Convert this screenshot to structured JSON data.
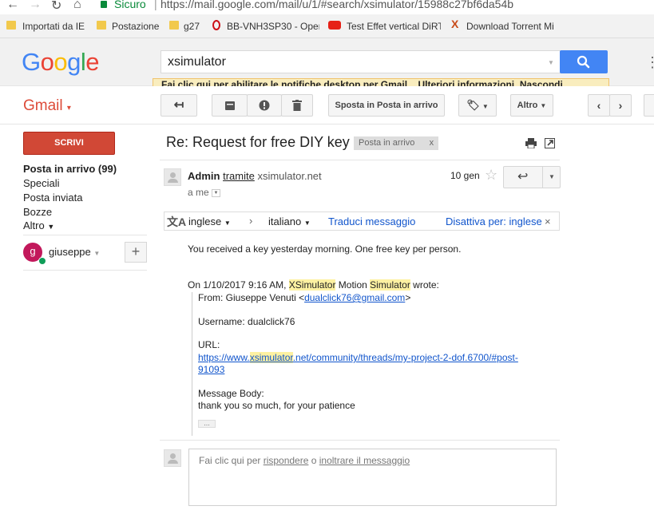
{
  "browser": {
    "secure_label": "Sicuro",
    "url": "https://mail.google.com/mail/u/1/#search/xsimulator/15988c27bf6da54b",
    "bookmarks": [
      {
        "label": "Importati da IE"
      },
      {
        "label": "Postazione"
      },
      {
        "label": "g27"
      },
      {
        "label": "BB-VNH3SP30 - Oper"
      },
      {
        "label": "Test Effet vertical DiRT"
      },
      {
        "label": "Download Torrent Mi"
      }
    ]
  },
  "header": {
    "logo": "Google",
    "search_value": "xsimulator"
  },
  "notification": {
    "enable_link": "Fai clic qui per abilitare",
    "text": " le notifiche desktop per Gmail.",
    "more_link": "Ulteriori informazioni",
    "hide_link": "Nascondi"
  },
  "toolbar": {
    "app_label": "Gmail",
    "move_inbox_label": "Sposta in Posta in arrivo",
    "more_label": "Altro"
  },
  "sidebar": {
    "compose_label": "SCRIVI",
    "items": [
      {
        "label": "Posta in arrivo (99)"
      },
      {
        "label": "Speciali"
      },
      {
        "label": "Posta inviata"
      },
      {
        "label": "Bozze"
      },
      {
        "label": "Altro"
      }
    ],
    "user_initial": "g",
    "user_name": "giuseppe"
  },
  "message": {
    "subject": "Re: Request for free DIY key",
    "label": "Posta in arrivo",
    "label_remove": "x",
    "sender": "Admin",
    "via": "tramite",
    "via_domain": "xsimulator.net",
    "date": "10 gen",
    "to": "a me",
    "translate": {
      "from_lang": "inglese",
      "to_lang": "italiano",
      "translate_link": "Traduci messaggio",
      "disable_link": "Disattiva per: inglese"
    },
    "body_line": "You received a key yesterday morning. One free key per person.",
    "quote_header_pre": "On 1/10/2017 9:16 AM, ",
    "quote_header_hl1": "XSimulator",
    "quote_header_mid": " Motion ",
    "quote_header_hl2": "Simulator",
    "quote_header_post": " wrote:",
    "from_label": "From: Giuseppe Venuti <",
    "from_email": "dualclick76@gmail.com",
    "from_close": ">",
    "username_line": "Username: dualclick76",
    "url_label": "URL:",
    "url_part1": "https://www.",
    "url_hl": "xsimulator",
    "url_part2": ".net/community/threads/my-project-2-dof.6700/#post-",
    "url_part3": "91093",
    "body_label": "Message Body:",
    "body_text": "thank you so much, for your patience",
    "ellipsis": "..."
  },
  "reply": {
    "pre": "Fai clic qui per ",
    "reply_link": "rispondere",
    "mid": " o ",
    "forward_link": "inoltrare il messaggio"
  }
}
